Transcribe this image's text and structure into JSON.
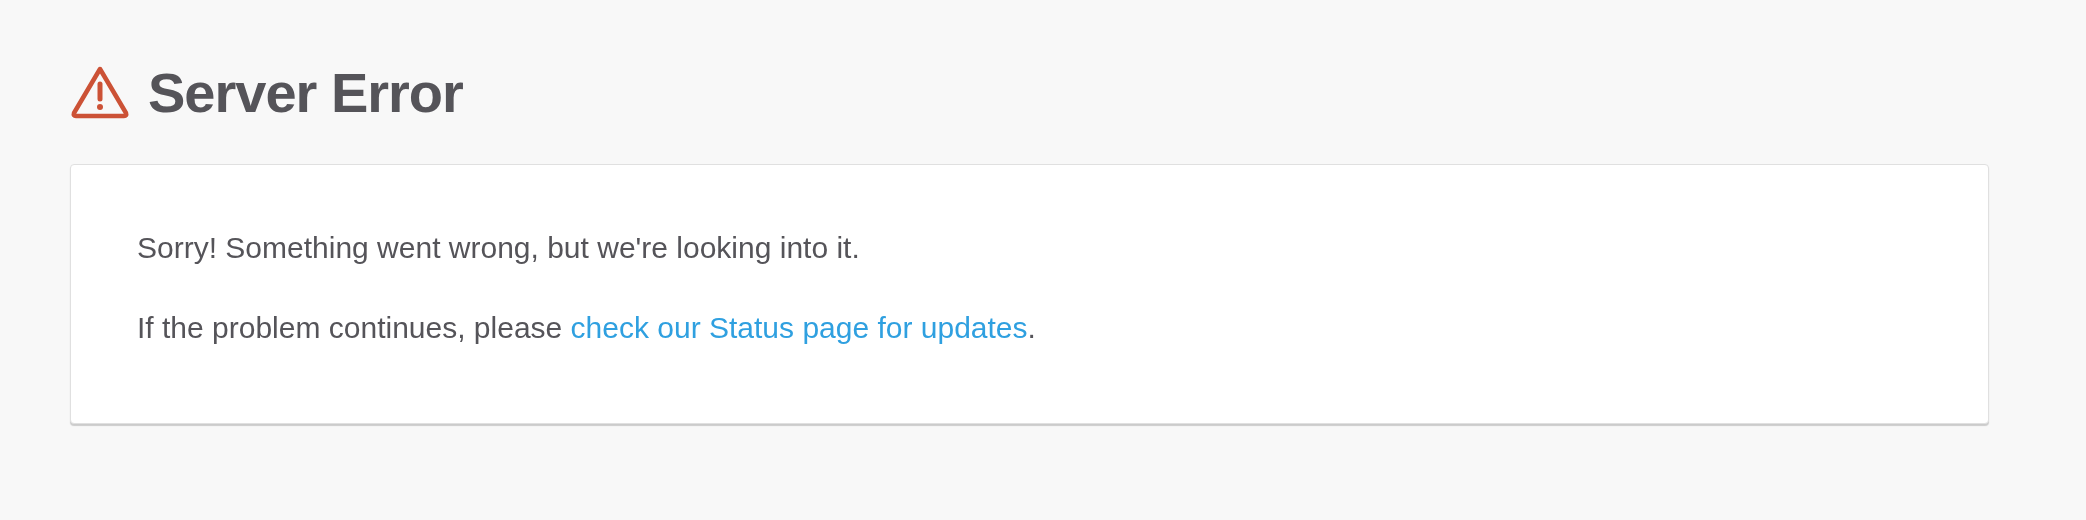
{
  "title": "Server Error",
  "message": "Sorry! Something went wrong, but we're looking into it.",
  "followup": {
    "before": "If the problem continues, please ",
    "link": "check our Status page for updates",
    "after": "."
  }
}
